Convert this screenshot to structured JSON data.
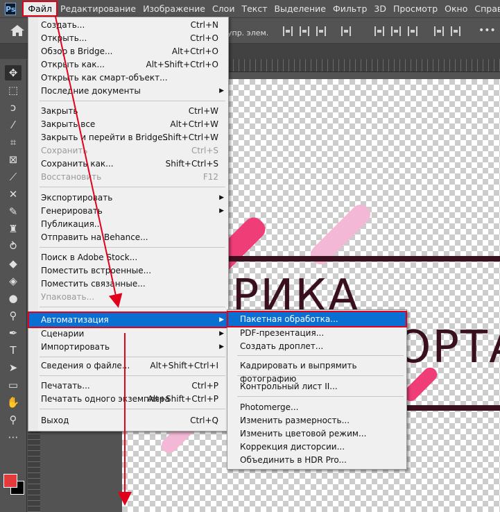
{
  "menubar": {
    "logo": "Ps",
    "items": [
      "Файл",
      "Редактирование",
      "Изображение",
      "Слои",
      "Текст",
      "Выделение",
      "Фильтр",
      "3D",
      "Просмотр",
      "Окно",
      "Справка"
    ]
  },
  "options": {
    "text": "упр. элем.",
    "more": "•••"
  },
  "file_menu": {
    "items": [
      {
        "label": "Создать...",
        "shortcut": "Ctrl+N"
      },
      {
        "label": "Открыть...",
        "shortcut": "Ctrl+O"
      },
      {
        "label": "Обзор в Bridge...",
        "shortcut": "Alt+Ctrl+O"
      },
      {
        "label": "Открыть как...",
        "shortcut": "Alt+Shift+Ctrl+O"
      },
      {
        "label": "Открыть как смарт-объект...",
        "shortcut": ""
      },
      {
        "label": "Последние документы",
        "shortcut": "",
        "submenu": true
      },
      {
        "label": "Закрыть",
        "shortcut": "Ctrl+W"
      },
      {
        "label": "Закрыть все",
        "shortcut": "Alt+Ctrl+W"
      },
      {
        "label": "Закрыть и перейти в Bridge...",
        "shortcut": "Shift+Ctrl+W"
      },
      {
        "label": "Сохранить",
        "shortcut": "Ctrl+S",
        "disabled": true
      },
      {
        "label": "Сохранить как...",
        "shortcut": "Shift+Ctrl+S"
      },
      {
        "label": "Восстановить",
        "shortcut": "F12",
        "disabled": true
      },
      {
        "label": "Экспортировать",
        "shortcut": "",
        "submenu": true
      },
      {
        "label": "Генерировать",
        "shortcut": "",
        "submenu": true
      },
      {
        "label": "Публикация...",
        "shortcut": ""
      },
      {
        "label": "Отправить на Behance...",
        "shortcut": ""
      },
      {
        "label": "Поиск в Adobe Stock...",
        "shortcut": ""
      },
      {
        "label": "Поместить встроенные...",
        "shortcut": ""
      },
      {
        "label": "Поместить связанные...",
        "shortcut": ""
      },
      {
        "label": "Упаковать...",
        "shortcut": "",
        "disabled": true
      },
      {
        "label": "Автоматизация",
        "shortcut": "",
        "submenu": true,
        "highlighted": true
      },
      {
        "label": "Сценарии",
        "shortcut": "",
        "submenu": true
      },
      {
        "label": "Импортировать",
        "shortcut": "",
        "submenu": true
      },
      {
        "label": "Сведения о файле...",
        "shortcut": "Alt+Shift+Ctrl+I"
      },
      {
        "label": "Печатать...",
        "shortcut": "Ctrl+P"
      },
      {
        "label": "Печатать одного экземпляра",
        "shortcut": "Alt+Shift+Ctrl+P"
      },
      {
        "label": "Выход",
        "shortcut": "Ctrl+Q"
      }
    ]
  },
  "automation_menu": {
    "items": [
      {
        "label": "Пакетная обработка...",
        "highlighted": true
      },
      {
        "label": "PDF-презентация..."
      },
      {
        "label": "Создать дроплет..."
      },
      {
        "label": "Кадрировать и выпрямить фотографию"
      },
      {
        "label": "Контрольный лист II..."
      },
      {
        "label": "Photomerge..."
      },
      {
        "label": "Изменить размерность..."
      },
      {
        "label": "Изменить цветовой режим..."
      },
      {
        "label": "Коррекция дисторсии..."
      },
      {
        "label": "Объединить в HDR Pro..."
      }
    ]
  },
  "canvas": {
    "line1": "ФАБРИКА",
    "line2": "ОРТА"
  },
  "colors": {
    "accent": "#0a6fd3",
    "highlight_border": "#e3001b",
    "foreground": "#e33b3b",
    "background": "#000000"
  },
  "tools": [
    "move-icon",
    "marquee-icon",
    "lasso-icon",
    "magic-wand-icon",
    "crop-icon",
    "frame-icon",
    "eyedropper-icon",
    "healing-icon",
    "brush-icon",
    "stamp-icon",
    "history-brush-icon",
    "eraser-icon",
    "bucket-icon",
    "blur-icon",
    "dodge-icon",
    "pen-icon",
    "type-icon",
    "path-select-icon",
    "rectangle-icon",
    "hand-icon",
    "zoom-icon",
    "more-tools-icon"
  ]
}
